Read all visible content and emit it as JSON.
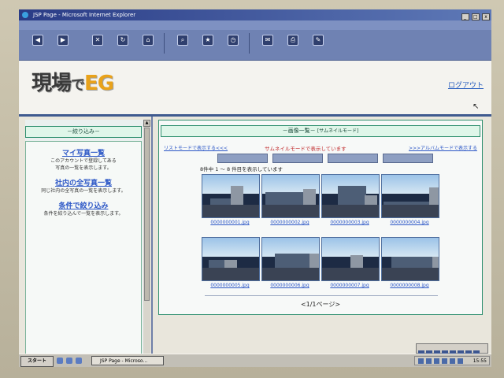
{
  "window": {
    "title": "JSP Page - Microsoft Internet Explorer",
    "buttons": [
      "_",
      "□",
      "x"
    ]
  },
  "header": {
    "logo_part1": "現場",
    "logo_part2": "で",
    "logo_part3": "EG",
    "logout": "ログアウト"
  },
  "sidebar": {
    "heading": "－絞り込み－",
    "items": [
      {
        "label": "マイ写真一覧",
        "desc1": "このアカウントで登録してある",
        "desc2": "写真の一覧を表示します。"
      },
      {
        "label": "社内の全写真一覧",
        "desc1": "同じ社内の全写真の一覧を表示します。",
        "desc2": ""
      },
      {
        "label": "条件で絞り込み",
        "desc1": "条件を絞り込んで一覧を表示します。",
        "desc2": ""
      }
    ]
  },
  "main": {
    "heading": "－画像一覧－",
    "mode_label": "[サムネイルモード]",
    "list_mode_link": "リストモードで表示する<<<",
    "current_mode": "サムネイルモードで表示しています",
    "album_mode_link": ">>>アルバムモードで表示する",
    "count_text": "8件中 1 ～ 8 件目を表示しています",
    "pager": "<1/1ページ>"
  },
  "images": [
    {
      "name": "0000000001.jpg"
    },
    {
      "name": "0000000002.jpg"
    },
    {
      "name": "0000000003.jpg"
    },
    {
      "name": "0000000004.jpg"
    },
    {
      "name": "0000000005.jpg"
    },
    {
      "name": "0000000006.jpg"
    },
    {
      "name": "0000000007.jpg"
    },
    {
      "name": "0000000008.jpg"
    }
  ],
  "taskbar": {
    "start": "スタート",
    "task": "JSP Page - Microso...",
    "clock": "15:55"
  },
  "colors": {
    "accent": "#2e8f6e",
    "link": "#2b56c6",
    "alert": "#c0282a",
    "logo_eg": "#e9a21a"
  }
}
